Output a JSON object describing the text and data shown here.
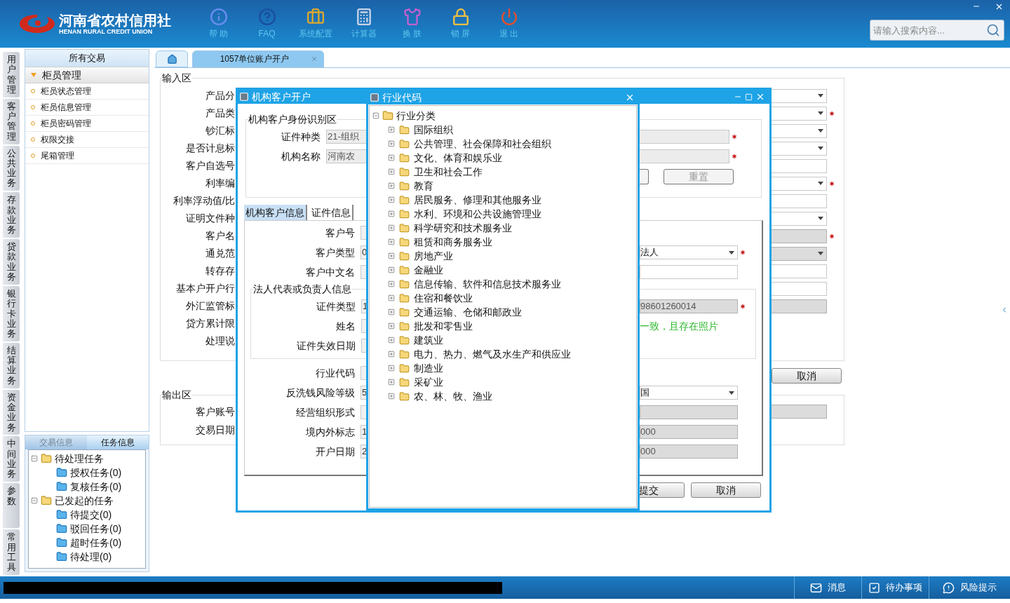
{
  "header": {
    "logo_cn": "河南省农村信用社",
    "logo_en": "HENAN RURAL CREDIT UNION",
    "toolbar": [
      {
        "kind": "info",
        "label": "帮 助"
      },
      {
        "kind": "help",
        "label": "FAQ"
      },
      {
        "kind": "config",
        "label": "系统配置"
      },
      {
        "kind": "calculator",
        "label": "计算器"
      },
      {
        "kind": "skin",
        "label": "换 肤"
      },
      {
        "kind": "lock",
        "label": "锁 屏"
      },
      {
        "kind": "exit",
        "label": "退 出"
      }
    ],
    "search": {
      "placeholder": "请输入搜索内容..."
    }
  },
  "side_tabs": [
    "用户管理",
    "客户管理",
    "公共业务",
    "存款业务",
    "贷款业务",
    "银行卡业务",
    "结算业务",
    "资金业务",
    "中间业务",
    "参数",
    "常用工具"
  ],
  "nav_panel": {
    "title": "所有交易",
    "group": {
      "label": "柜员管理",
      "expanded": true,
      "items": [
        "柜员状态管理",
        "柜员信息管理",
        "柜员密码管理",
        "权限交接",
        "尾箱管理"
      ]
    }
  },
  "task_panel": {
    "tabs": [
      {
        "label": "交易信息",
        "selected": false
      },
      {
        "label": "任务信息",
        "selected": true
      }
    ],
    "tree": [
      {
        "label": "待处理任务",
        "expanded": true,
        "children": [
          {
            "label": "授权任务(0)"
          },
          {
            "label": "复核任务(0)"
          }
        ]
      },
      {
        "label": "已发起的任务",
        "expanded": true,
        "children": [
          {
            "label": "待提交(0)"
          },
          {
            "label": "驳回任务(0)"
          },
          {
            "label": "超时任务(0)"
          },
          {
            "label": "待处理(0)"
          }
        ]
      }
    ]
  },
  "main_tabs": [
    {
      "kind": "home",
      "selected": false
    },
    {
      "kind": "page",
      "label": "1057单位账户开户",
      "selected": true
    }
  ],
  "input_area": {
    "title": "输入区",
    "rows": [
      {
        "label": "产品分",
        "field": {
          "kind": "select",
          "required": false,
          "disabled": false
        }
      },
      {
        "label": "产品类",
        "field": {
          "kind": "select",
          "required": true,
          "disabled": false
        }
      },
      {
        "label": "钞汇标",
        "field": {
          "kind": "select",
          "required": false,
          "disabled": false
        }
      },
      {
        "label": "是否计息标",
        "field": {
          "kind": "select",
          "required": false,
          "disabled": false
        }
      },
      {
        "label": "客户自选号",
        "field": {
          "kind": "text",
          "required": false,
          "disabled": false
        }
      },
      {
        "label": "利率编",
        "field": {
          "kind": "select",
          "required": true,
          "disabled": false
        }
      },
      {
        "label": "利率浮动值/比",
        "field": {
          "kind": "text",
          "required": false,
          "disabled": false
        }
      },
      {
        "label": "证明文件种",
        "field": {
          "kind": "select",
          "required": false,
          "disabled": false
        }
      },
      {
        "label": "客户名",
        "field": {
          "kind": "text",
          "required": true,
          "disabled": true
        }
      },
      {
        "label": "通兑范",
        "field": {
          "kind": "select",
          "required": false,
          "disabled": true
        }
      },
      {
        "label": "转存存",
        "field": {
          "kind": "text",
          "required": false,
          "disabled": false
        }
      },
      {
        "label": "基本户开户行",
        "field": {
          "kind": "text",
          "required": false,
          "disabled": false
        }
      },
      {
        "label": "外汇监管标",
        "field": {
          "kind": "text",
          "required": false,
          "disabled": true
        }
      },
      {
        "label": "贷方累计限"
      },
      {
        "label": "处理说"
      }
    ]
  },
  "cancel_button": "取消",
  "output_area": {
    "title": "输出区",
    "rows": [
      {
        "label": "客户账号",
        "field": {
          "kind": "text",
          "required": false,
          "disabled": true
        }
      },
      {
        "label": "交易日期"
      }
    ]
  },
  "customer_dialog": {
    "title": "机构客户开户",
    "id_section": {
      "title": "机构客户身份识别区",
      "rows": [
        {
          "label": "证件种类",
          "value": "21-组织",
          "required": true
        },
        {
          "label": "机构名称",
          "value": "河南农",
          "required": true
        }
      ],
      "reset_button": "重置"
    },
    "tabs": [
      {
        "label": "机构客户信息",
        "selected": true
      },
      {
        "label": "证件信息",
        "selected": false
      }
    ],
    "rows": [
      {
        "label": "客户号"
      },
      {
        "label": "客户类型",
        "value": "0",
        "right": {
          "kind": "select",
          "value": "法人",
          "required": true,
          "disabled": false
        }
      },
      {
        "label": "客户中文名",
        "right": {
          "kind": "text",
          "required": false,
          "disabled": false
        }
      }
    ],
    "group": {
      "title": "法人代表或负责人信息",
      "rows": [
        {
          "label": "证件类型",
          "value": "1",
          "right": {
            "kind": "text",
            "value": "98601260014",
            "required": true,
            "disabled": true
          }
        },
        {
          "label": "姓名",
          "right": {
            "kind": "message",
            "value": "一致，且存在照片"
          }
        },
        {
          "label": "证件失效日期"
        }
      ]
    },
    "rows_after": [
      {
        "label": "行业代码"
      },
      {
        "label": "反洗钱风险等级",
        "value": "5",
        "right": {
          "kind": "select",
          "value": "国",
          "required": false,
          "disabled": false
        }
      },
      {
        "label": "经营组织形式",
        "right": {
          "kind": "text",
          "required": false,
          "disabled": true
        }
      },
      {
        "label": "境内外标志",
        "value": "1",
        "right": {
          "kind": "text",
          "value": "000",
          "required": false,
          "disabled": true
        }
      },
      {
        "label": "开户日期",
        "value": "2",
        "right": {
          "kind": "text",
          "value": "000",
          "required": false,
          "disabled": true
        }
      }
    ],
    "buttons": [
      "提交",
      "取消"
    ]
  },
  "industry_dialog": {
    "title": "行业代码",
    "tree": {
      "label": "行业分类",
      "expanded": true,
      "children": [
        {
          "label": "国际组织",
          "expanded": false
        },
        {
          "label": "公共管理、社会保障和社会组织",
          "expanded": false
        },
        {
          "label": "文化、体育和娱乐业",
          "expanded": false
        },
        {
          "label": "卫生和社会工作",
          "expanded": false
        },
        {
          "label": "教育",
          "expanded": false
        },
        {
          "label": "居民服务、修理和其他服务业",
          "expanded": false
        },
        {
          "label": "水利、环境和公共设施管理业",
          "expanded": false
        },
        {
          "label": "科学研究和技术服务业",
          "expanded": false
        },
        {
          "label": "租赁和商务服务业",
          "expanded": false
        },
        {
          "label": "房地产业",
          "expanded": false
        },
        {
          "label": "金融业",
          "expanded": false
        },
        {
          "label": "信息传输、软件和信息技术服务业",
          "expanded": false
        },
        {
          "label": "住宿和餐饮业",
          "expanded": false
        },
        {
          "label": "交通运输、仓储和邮政业",
          "expanded": false
        },
        {
          "label": "批发和零售业",
          "expanded": false
        },
        {
          "label": "建筑业",
          "expanded": false
        },
        {
          "label": "电力、热力、燃气及水生产和供应业",
          "expanded": false
        },
        {
          "label": "制造业",
          "expanded": false
        },
        {
          "label": "采矿业",
          "expanded": false
        },
        {
          "label": "农、林、牧、渔业",
          "expanded": false
        }
      ]
    }
  },
  "status_bar": {
    "items": [
      {
        "kind": "message",
        "label": "消息"
      },
      {
        "kind": "todo",
        "label": "待办事项"
      },
      {
        "kind": "risk",
        "label": "风险提示"
      }
    ]
  }
}
